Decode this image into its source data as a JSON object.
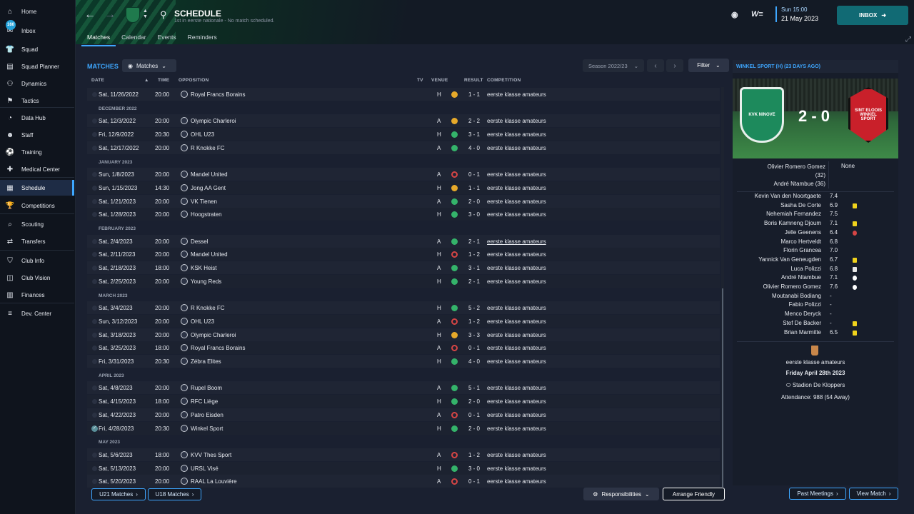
{
  "sidebar": {
    "items": [
      {
        "label": "Home",
        "icon": "home-icon"
      },
      {
        "label": "Inbox",
        "icon": "inbox-icon",
        "badge": "160"
      },
      {
        "label": "Squad",
        "icon": "shirt-icon"
      },
      {
        "label": "Squad Planner",
        "icon": "clipboard-icon"
      },
      {
        "label": "Dynamics",
        "icon": "dynamics-icon"
      },
      {
        "label": "Tactics",
        "icon": "tactics-icon"
      },
      {
        "label": "Data Hub",
        "icon": "data-hub-icon"
      },
      {
        "label": "Staff",
        "icon": "staff-icon"
      },
      {
        "label": "Training",
        "icon": "training-icon"
      },
      {
        "label": "Medical Center",
        "icon": "medical-icon"
      },
      {
        "label": "Schedule",
        "icon": "calendar-icon"
      },
      {
        "label": "Competitions",
        "icon": "trophy-icon"
      },
      {
        "label": "Scouting",
        "icon": "scouting-icon"
      },
      {
        "label": "Transfers",
        "icon": "transfers-icon"
      },
      {
        "label": "Club Info",
        "icon": "shield-icon"
      },
      {
        "label": "Club Vision",
        "icon": "vision-icon"
      },
      {
        "label": "Finances",
        "icon": "finances-icon"
      },
      {
        "label": "Dev. Center",
        "icon": "dev-center-icon"
      }
    ]
  },
  "header": {
    "title": "SCHEDULE",
    "subtitle": "1st in eerste nationale - No match scheduled.",
    "tabs": [
      "Matches",
      "Calendar",
      "Events",
      "Reminders"
    ],
    "time": "Sun 15:00",
    "date": "21 May 2023",
    "inbox_label": "INBOX"
  },
  "matches_panel": {
    "title": "MATCHES",
    "view_dropdown": "Matches",
    "season": "Season 2022/23",
    "filter_label": "Filter",
    "columns": {
      "date": "DATE",
      "time": "TIME",
      "opposition": "OPPOSITION",
      "tv": "TV",
      "venue": "VENUE",
      "result": "RESULT",
      "competition": "COMPETITION"
    },
    "rows": [
      {
        "kind": "match",
        "date": "Sat, 11/26/2022",
        "time": "20:00",
        "opp": "Royal Francs Borains",
        "venue": "H",
        "outcome": "draw",
        "result": "1 - 1",
        "comp": "eerste klasse amateurs"
      },
      {
        "kind": "month",
        "label": "DECEMBER 2022"
      },
      {
        "kind": "match",
        "date": "Sat, 12/3/2022",
        "time": "20:00",
        "opp": "Olympic Charleroi",
        "venue": "A",
        "outcome": "draw",
        "result": "2 - 2",
        "comp": "eerste klasse amateurs"
      },
      {
        "kind": "match",
        "date": "Fri, 12/9/2022",
        "time": "20:30",
        "opp": "OHL U23",
        "venue": "H",
        "outcome": "win",
        "result": "3 - 1",
        "comp": "eerste klasse amateurs"
      },
      {
        "kind": "match",
        "date": "Sat, 12/17/2022",
        "time": "20:00",
        "opp": "R Knokke FC",
        "venue": "A",
        "outcome": "win",
        "result": "4 - 0",
        "comp": "eerste klasse amateurs"
      },
      {
        "kind": "month",
        "label": "JANUARY 2023"
      },
      {
        "kind": "match",
        "date": "Sun, 1/8/2023",
        "time": "20:00",
        "opp": "Mandel United",
        "venue": "A",
        "outcome": "loss",
        "result": "0 - 1",
        "comp": "eerste klasse amateurs"
      },
      {
        "kind": "match",
        "date": "Sun, 1/15/2023",
        "time": "14:30",
        "opp": "Jong AA Gent",
        "venue": "H",
        "outcome": "draw",
        "result": "1 - 1",
        "comp": "eerste klasse amateurs"
      },
      {
        "kind": "match",
        "date": "Sat, 1/21/2023",
        "time": "20:00",
        "opp": "VK Tienen",
        "venue": "A",
        "outcome": "win",
        "result": "2 - 0",
        "comp": "eerste klasse amateurs"
      },
      {
        "kind": "match",
        "date": "Sat, 1/28/2023",
        "time": "20:00",
        "opp": "Hoogstraten",
        "venue": "H",
        "outcome": "win",
        "result": "3 - 0",
        "comp": "eerste klasse amateurs"
      },
      {
        "kind": "month",
        "label": "FEBRUARY 2023"
      },
      {
        "kind": "match",
        "date": "Sat, 2/4/2023",
        "time": "20:00",
        "opp": "Dessel",
        "venue": "A",
        "outcome": "win",
        "result": "2 - 1",
        "comp": "eerste klasse amateurs"
      },
      {
        "kind": "match",
        "date": "Sat, 2/11/2023",
        "time": "20:00",
        "opp": "Mandel United",
        "venue": "H",
        "outcome": "loss",
        "result": "1 - 2",
        "comp": "eerste klasse amateurs"
      },
      {
        "kind": "match",
        "date": "Sat, 2/18/2023",
        "time": "18:00",
        "opp": "KSK Heist",
        "venue": "A",
        "outcome": "win",
        "result": "3 - 1",
        "comp": "eerste klasse amateurs"
      },
      {
        "kind": "match",
        "date": "Sat, 2/25/2023",
        "time": "20:00",
        "opp": "Young Reds",
        "venue": "H",
        "outcome": "win",
        "result": "2 - 1",
        "comp": "eerste klasse amateurs"
      },
      {
        "kind": "month",
        "label": "MARCH 2023"
      },
      {
        "kind": "match",
        "date": "Sat, 3/4/2023",
        "time": "20:00",
        "opp": "R Knokke FC",
        "venue": "H",
        "outcome": "win",
        "result": "5 - 2",
        "comp": "eerste klasse amateurs"
      },
      {
        "kind": "match",
        "date": "Sun, 3/12/2023",
        "time": "20:00",
        "opp": "OHL U23",
        "venue": "A",
        "outcome": "loss",
        "result": "1 - 2",
        "comp": "eerste klasse amateurs"
      },
      {
        "kind": "match",
        "date": "Sat, 3/18/2023",
        "time": "20:00",
        "opp": "Olympic Charleroi",
        "venue": "H",
        "outcome": "draw",
        "result": "3 - 3",
        "comp": "eerste klasse amateurs"
      },
      {
        "kind": "match",
        "date": "Sat, 3/25/2023",
        "time": "18:00",
        "opp": "Royal Francs Borains",
        "venue": "A",
        "outcome": "loss",
        "result": "0 - 1",
        "comp": "eerste klasse amateurs"
      },
      {
        "kind": "match",
        "date": "Fri, 3/31/2023",
        "time": "20:30",
        "opp": "Zébra Elites",
        "venue": "H",
        "outcome": "win",
        "result": "4 - 0",
        "comp": "eerste klasse amateurs"
      },
      {
        "kind": "month",
        "label": "APRIL 2023"
      },
      {
        "kind": "match",
        "date": "Sat, 4/8/2023",
        "time": "20:00",
        "opp": "Rupel Boom",
        "venue": "A",
        "outcome": "win",
        "result": "5 - 1",
        "comp": "eerste klasse amateurs"
      },
      {
        "kind": "match",
        "date": "Sat, 4/15/2023",
        "time": "18:00",
        "opp": "RFC Liège",
        "venue": "H",
        "outcome": "win",
        "result": "2 - 0",
        "comp": "eerste klasse amateurs"
      },
      {
        "kind": "match",
        "date": "Sat, 4/22/2023",
        "time": "20:00",
        "opp": "Patro Eisden",
        "venue": "A",
        "outcome": "loss",
        "result": "0 - 1",
        "comp": "eerste klasse amateurs"
      },
      {
        "kind": "match",
        "date": "Fri, 4/28/2023",
        "time": "20:30",
        "opp": "Winkel Sport",
        "venue": "H",
        "outcome": "win",
        "result": "2 - 0",
        "comp": "eerste klasse amateurs",
        "selected": true
      },
      {
        "kind": "month",
        "label": "MAY 2023"
      },
      {
        "kind": "match",
        "date": "Sat, 5/6/2023",
        "time": "18:00",
        "opp": "KVV Thes Sport",
        "venue": "A",
        "outcome": "loss",
        "result": "1 - 2",
        "comp": "eerste klasse amateurs"
      },
      {
        "kind": "match",
        "date": "Sat, 5/13/2023",
        "time": "20:00",
        "opp": "URSL Visé",
        "venue": "H",
        "outcome": "win",
        "result": "3 - 0",
        "comp": "eerste klasse amateurs"
      },
      {
        "kind": "match",
        "date": "Sat, 5/20/2023",
        "time": "20:00",
        "opp": "RAAL La Louvière",
        "venue": "A",
        "outcome": "loss",
        "result": "0 - 1",
        "comp": "eerste klasse amateurs"
      }
    ],
    "footer": {
      "u21": "U21 Matches",
      "u18": "U18 Matches",
      "responsibilities": "Responsibilities",
      "arrange_friendly": "Arrange Friendly"
    }
  },
  "match_detail": {
    "title": "WINKEL SPORT (H) (23 DAYS AGO)",
    "home_crest_text": "KVK NINOVE",
    "away_crest_text": "SINT ELOOIS WINKEL SPORT",
    "score": "2 - 0",
    "home_scorers": [
      "Olivier Romero Gomez",
      "(32)",
      "André Ntambue (36)"
    ],
    "away_scorers": "None",
    "lineup": [
      {
        "name": "Kevin Van den Noortgaete",
        "rating": "7.4",
        "event": ""
      },
      {
        "name": "Sasha De Corte",
        "rating": "6.9",
        "event": "yellow"
      },
      {
        "name": "Nehemiah Fernandez",
        "rating": "7.5",
        "event": ""
      },
      {
        "name": "Boris Kamneng Djoum",
        "rating": "7.1",
        "event": "yellow"
      },
      {
        "name": "Jelle Geenens",
        "rating": "6.4",
        "event": "red"
      },
      {
        "name": "Marco Hertveldt",
        "rating": "6.8",
        "event": ""
      },
      {
        "name": "Florin Grancea",
        "rating": "7.0",
        "event": ""
      },
      {
        "name": "Yannick Van Geneugden",
        "rating": "6.7",
        "event": "yellow"
      },
      {
        "name": "Luca Polizzi",
        "rating": "6.8",
        "event": "sub"
      },
      {
        "name": "André Ntambue",
        "rating": "7.1",
        "event": "goal"
      },
      {
        "name": "Olivier Romero Gomez",
        "rating": "7.6",
        "event": "goal"
      },
      {
        "name": "Moutanabi Bodiang",
        "rating": "-",
        "event": ""
      },
      {
        "name": "Fabio Polizzi",
        "rating": "-",
        "event": ""
      },
      {
        "name": "Menco Deryck",
        "rating": "-",
        "event": ""
      },
      {
        "name": "Stef De Backer",
        "rating": "-",
        "event": "yellow"
      },
      {
        "name": "Brian Marmitte",
        "rating": "6.5",
        "event": "yellow"
      }
    ],
    "competition": "eerste klasse amateurs",
    "date": "Friday April 28th 2023",
    "stadium": "Stadion De Kloppers",
    "attendance": "Attendance: 988 (54 Away)",
    "past_meetings": "Past Meetings",
    "view_match": "View Match"
  }
}
